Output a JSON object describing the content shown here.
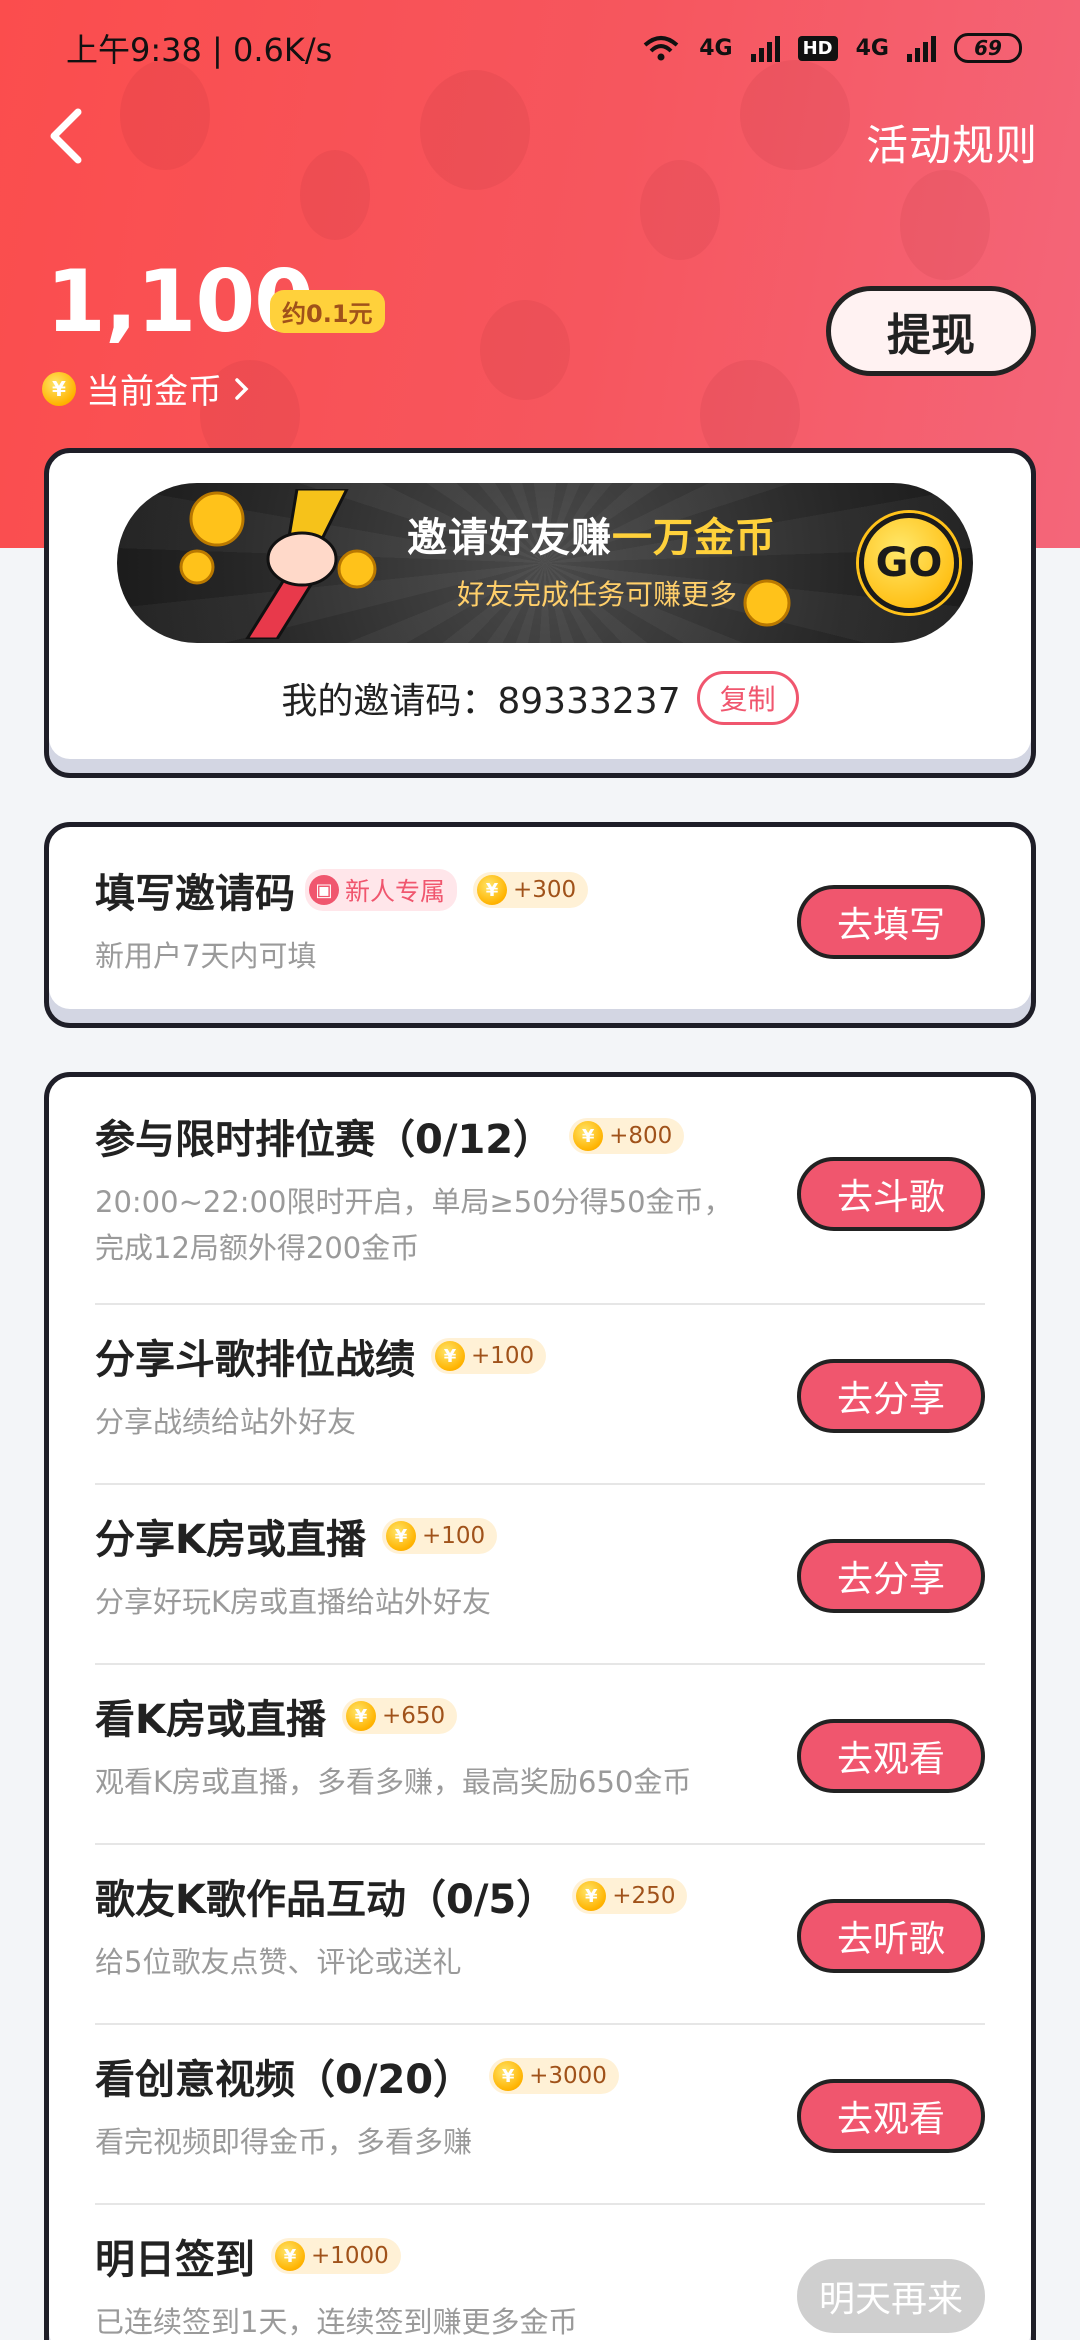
{
  "status_bar": {
    "time": "上午9:38 | 0.6K/s",
    "network1": "4G",
    "hd": "HD",
    "network2": "4G",
    "battery": "69"
  },
  "header": {
    "rules_label": "活动规则",
    "coin_amount": "1,100",
    "approx_value": "约0.1元",
    "current_coins_label": "当前金币",
    "withdraw_label": "提现"
  },
  "invite": {
    "banner_title_prefix": "邀请好友赚",
    "banner_title_highlight": "一万金币",
    "banner_subtitle": "好友完成任务可赚更多",
    "go_label": "GO",
    "code_label": "我的邀请码：",
    "code_value": "89333237",
    "copy_label": "复制"
  },
  "fill_code": {
    "title": "填写邀请码",
    "tag": "新人专属",
    "reward": "+300",
    "desc": "新用户7天内可填",
    "button": "去填写"
  },
  "tasks": [
    {
      "title": "参与限时排位赛（0/12）",
      "reward": "+800",
      "desc_lines": [
        "20:00~22:00限时开启，单局≥50分得50金币，",
        "完成12局额外得200金币"
      ],
      "button": "去斗歌"
    },
    {
      "title": "分享斗歌排位战绩",
      "reward": "+100",
      "desc_lines": [
        "分享战绩给站外好友"
      ],
      "button": "去分享"
    },
    {
      "title": "分享K房或直播",
      "reward": "+100",
      "desc_lines": [
        "分享好玩K房或直播给站外好友"
      ],
      "button": "去分享"
    },
    {
      "title": "看K房或直播",
      "reward": "+650",
      "desc_lines": [
        "观看K房或直播，多看多赚，最高奖励650金币"
      ],
      "button": "去观看"
    },
    {
      "title": "歌友K歌作品互动（0/5）",
      "reward": "+250",
      "desc_lines": [
        "给5位歌友点赞、评论或送礼"
      ],
      "button": "去听歌"
    },
    {
      "title": "看创意视频（0/20）",
      "reward": "+3000",
      "desc_lines": [
        "看完视频即得金币，多看多赚"
      ],
      "button": "去观看"
    },
    {
      "title": "明日签到",
      "reward": "+1000",
      "desc_lines": [
        "已连续签到1天，连续签到赚更多金币"
      ],
      "button": "明天再来"
    }
  ],
  "coin_glyph": "¥"
}
